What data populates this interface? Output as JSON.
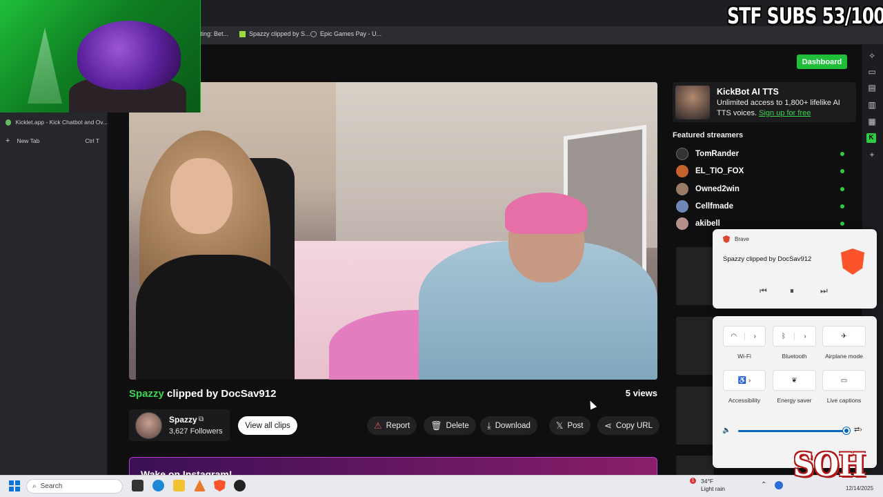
{
  "overlay": {
    "subs_counter": "STF SUBS 53/100",
    "logo_text": "SOH"
  },
  "bookmarks": [
    {
      "label": "tting: Bet..."
    },
    {
      "label": "Spazzy clipped by S..."
    },
    {
      "label": "Epic Games Pay - U..."
    }
  ],
  "sidebar": {
    "tabs": [
      {
        "label": "Kicklet.app - Kick Chatbot and Ov..."
      },
      {
        "label": "New Tab",
        "shortcut": "Ctrl T"
      }
    ]
  },
  "header": {
    "dashboard_label": "Dashboard"
  },
  "clip": {
    "streamer": "Spazzy",
    "title_suffix": "clipped by DocSav912",
    "views": "5 views",
    "channel_name": "Spazzy",
    "followers": "3,627 Followers",
    "view_all_label": "View all clips"
  },
  "actions": {
    "report": "Report",
    "delete": "Delete",
    "download": "Download",
    "post": "Post",
    "copy_url": "Copy URL"
  },
  "banner": {
    "text": "Wake on Instagram!"
  },
  "ad": {
    "title": "KickBot AI TTS",
    "text": "Unlimited access to 1,800+ lifelike AI TTS voices.",
    "link": "Sign up for free"
  },
  "featured": {
    "heading": "Featured streamers",
    "items": [
      {
        "name": "TomRander"
      },
      {
        "name": "EL_TIO_FOX"
      },
      {
        "name": "Owned2win"
      },
      {
        "name": "Cellfmade"
      },
      {
        "name": "akibell"
      }
    ]
  },
  "media": {
    "app": "Brave",
    "title": "Spazzy clipped by DocSav912"
  },
  "quick_settings": {
    "wifi": "Wi-Fi",
    "bluetooth": "Bluetooth",
    "airplane": "Airplane mode",
    "accessibility": "Accessibility",
    "energy": "Energy saver",
    "captions": "Live captions",
    "volume_percent": 100
  },
  "taskbar": {
    "search_placeholder": "Search",
    "weather_temp": "34°F",
    "weather_desc": "Light rain",
    "weather_badge": "1",
    "date": "12/14/2025"
  },
  "colors": {
    "kick_green": "#3bd650",
    "dashboard_green": "#1fbf3a",
    "brave_orange": "#fb542b",
    "windows_blue": "#0067c0"
  }
}
